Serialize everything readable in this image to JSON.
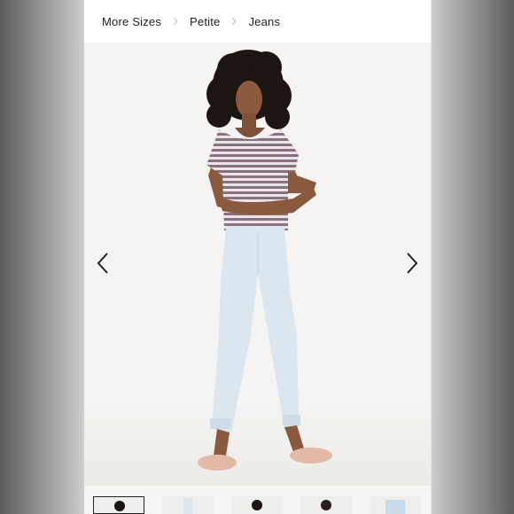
{
  "breadcrumb": {
    "items": [
      {
        "label": "More Sizes"
      },
      {
        "label": "Petite"
      },
      {
        "label": "Jeans"
      }
    ]
  },
  "gallery": {
    "prev_icon": "chevron-left-icon",
    "next_icon": "chevron-right-icon",
    "thumbnail_count": 6,
    "active_index": 0
  },
  "colors": {
    "page_background": "#f7f7f7",
    "photo_background": "#f5f4f2",
    "text": "#1e1e1e",
    "arrow": "#222222",
    "jeans": "#dbe6ef",
    "tee_stripe_1": "#8a7180",
    "tee_stripe_2": "#e9e4e6",
    "sandals": "#e2b9a6"
  }
}
